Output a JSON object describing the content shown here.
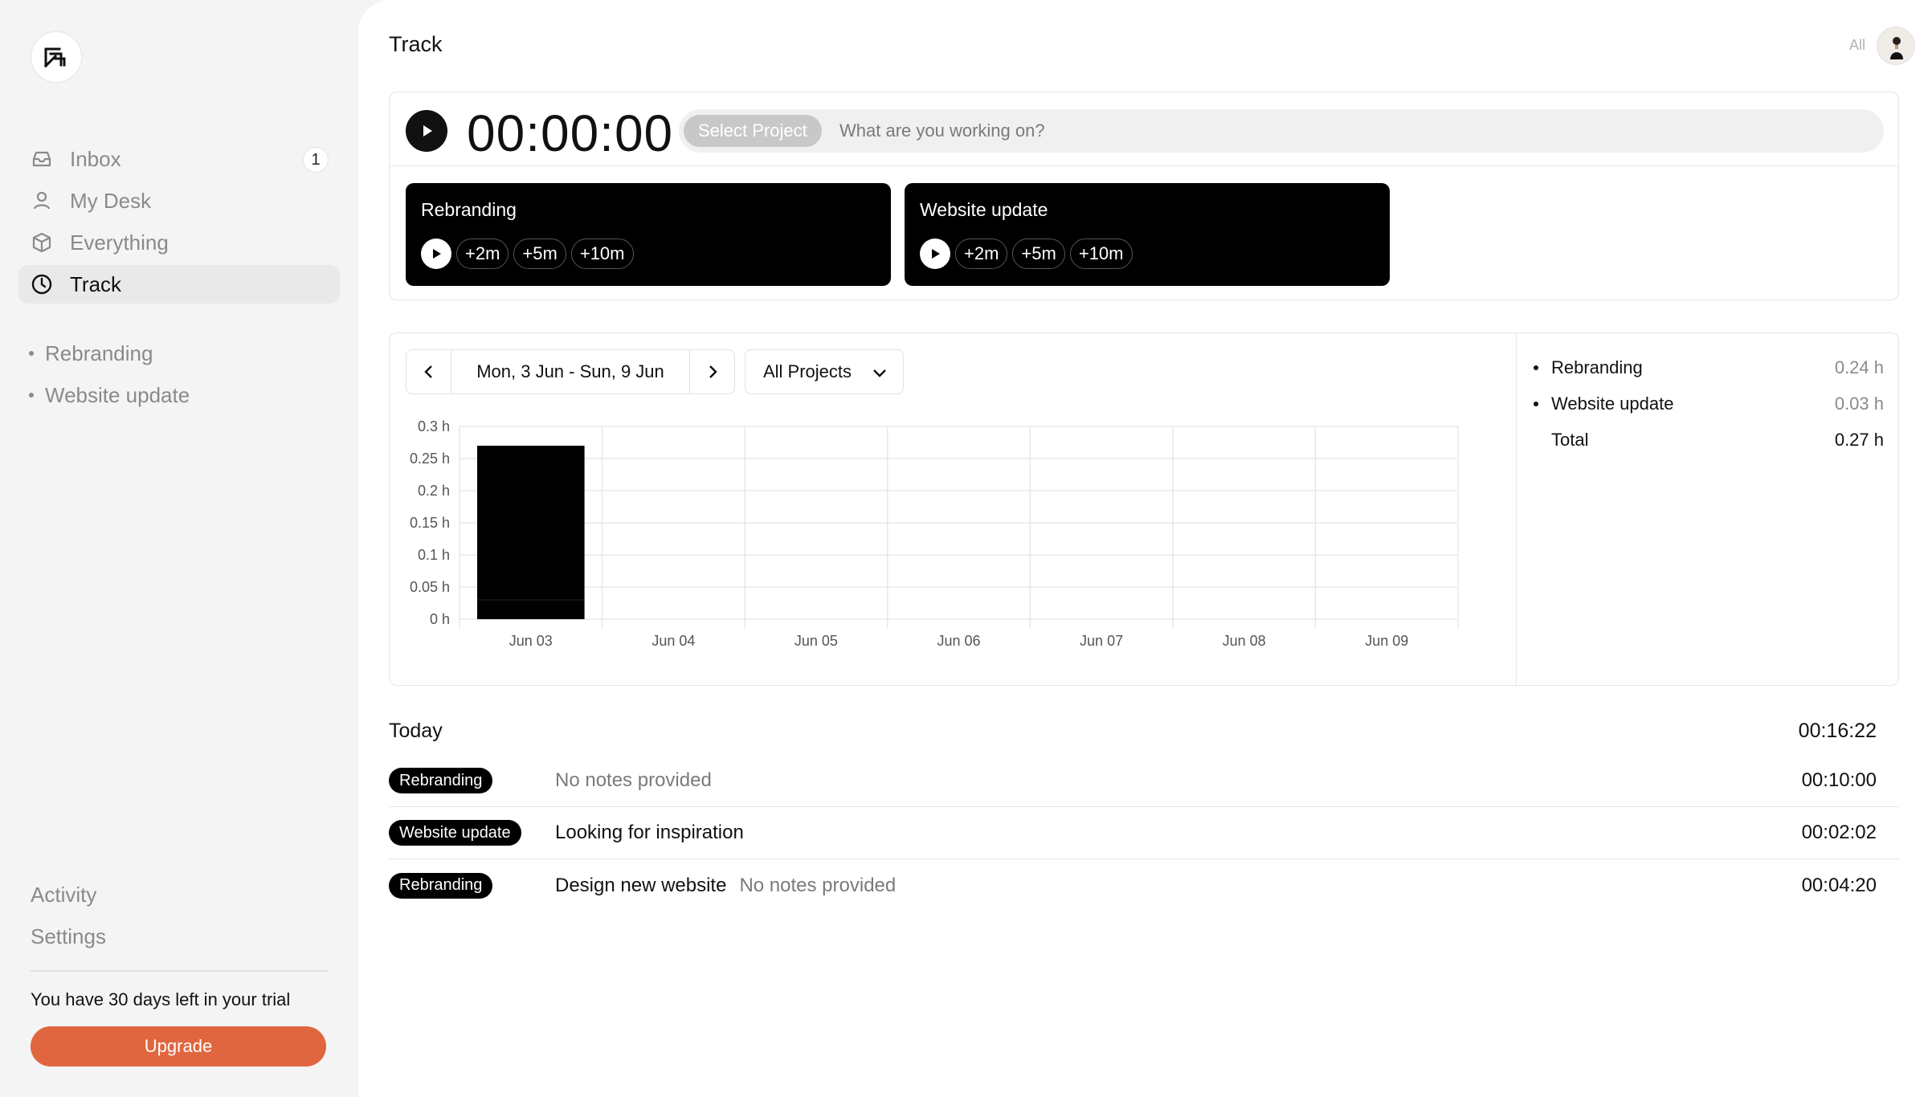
{
  "sidebar": {
    "nav": [
      {
        "label": "Inbox",
        "badge": "1",
        "icon": "inbox-icon"
      },
      {
        "label": "My Desk",
        "icon": "user-icon"
      },
      {
        "label": "Everything",
        "icon": "box-icon"
      },
      {
        "label": "Track",
        "icon": "clock-icon",
        "active": true
      }
    ],
    "projects": [
      "Rebranding",
      "Website update"
    ],
    "bottom": [
      "Activity",
      "Settings"
    ],
    "trial_text": "You have 30 days left in your trial",
    "upgrade_label": "Upgrade"
  },
  "header": {
    "title": "Track",
    "filter_label": "All"
  },
  "timer": {
    "display": "00:00:00",
    "select_project": "Select Project",
    "placeholder": "What are you working on?"
  },
  "quick_projects": [
    {
      "name": "Rebranding",
      "buttons": [
        "+2m",
        "+5m",
        "+10m"
      ]
    },
    {
      "name": "Website update",
      "buttons": [
        "+2m",
        "+5m",
        "+10m"
      ]
    }
  ],
  "chart_controls": {
    "date_range": "Mon, 3 Jun - Sun, 9 Jun",
    "project_filter": "All Projects"
  },
  "summary": [
    {
      "label": "Rebranding",
      "value": "0.24 h"
    },
    {
      "label": "Website update",
      "value": "0.03 h"
    },
    {
      "label": "Total",
      "value": "0.27 h"
    }
  ],
  "chart_data": {
    "type": "bar",
    "categories": [
      "Jun 03",
      "Jun 04",
      "Jun 05",
      "Jun 06",
      "Jun 07",
      "Jun 08",
      "Jun 09"
    ],
    "series": [
      {
        "name": "Rebranding",
        "values": [
          0.24,
          0,
          0,
          0,
          0,
          0,
          0
        ]
      },
      {
        "name": "Website update",
        "values": [
          0.03,
          0,
          0,
          0,
          0,
          0,
          0
        ]
      }
    ],
    "stacked": true,
    "ylim": [
      0,
      0.3
    ],
    "yticks": [
      "0 h",
      "0.05 h",
      "0.1 h",
      "0.15 h",
      "0.2 h",
      "0.25 h",
      "0.3 h"
    ],
    "grid": true,
    "bar_color": "#000000"
  },
  "today": {
    "label": "Today",
    "total": "00:16:22",
    "entries": [
      {
        "tag": "Rebranding",
        "title": "",
        "note": "No notes provided",
        "duration": "00:10:00"
      },
      {
        "tag": "Website update",
        "title": "Looking for inspiration",
        "note": "",
        "duration": "00:02:02"
      },
      {
        "tag": "Rebranding",
        "title": "Design new website",
        "note": "No notes provided",
        "duration": "00:04:20"
      }
    ]
  },
  "colors": {
    "accent": "#e0663f",
    "sidebar_bg": "#f4f4f4",
    "card_dark": "#000000"
  }
}
